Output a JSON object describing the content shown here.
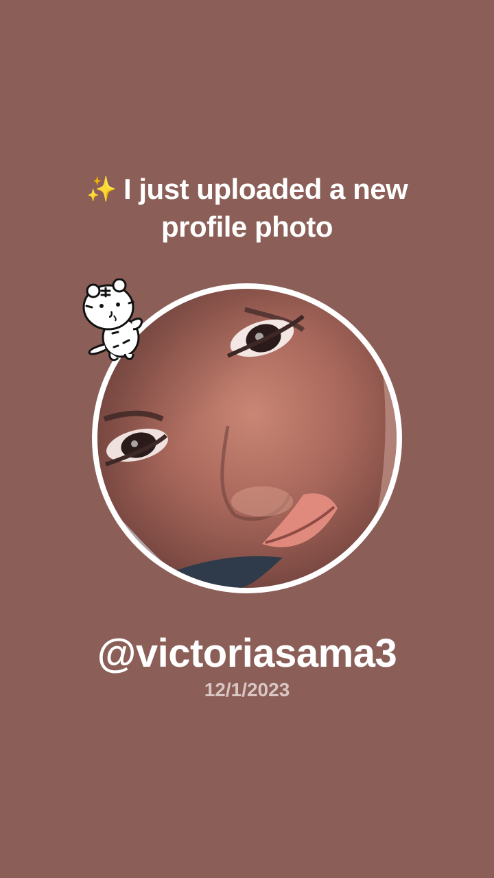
{
  "theme": {
    "background": "#8b5f58",
    "text_primary": "#ffffff",
    "text_secondary": "#d9c6c2"
  },
  "announcement": {
    "sparkle_emoji": "✨",
    "text": "I just uploaded a new profile photo"
  },
  "profile": {
    "username": "@victoriasama3",
    "date": "12/1/2023",
    "avatar_icon": "profile-photo",
    "sticker_icon": "tiger-sticker-icon"
  }
}
